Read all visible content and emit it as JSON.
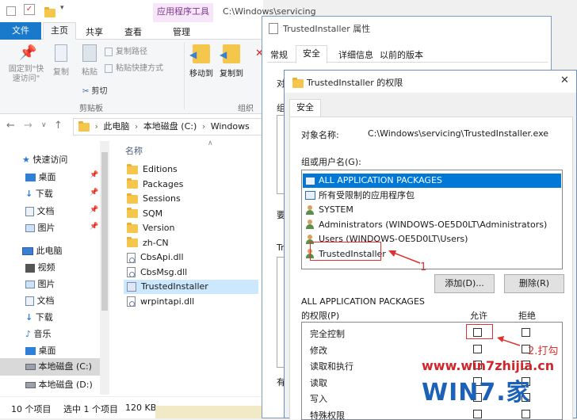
{
  "explorer": {
    "title_path": "C:\\Windows\\servicing",
    "app_tools_tab": "应用程序工具",
    "ribbon_tabs": [
      "文件",
      "主页",
      "共享",
      "查看",
      "管理"
    ],
    "pin_label": "固定到\"快\n速访问\"",
    "copy_label": "复制",
    "paste_label": "粘贴",
    "copy_path_label": "复制路径",
    "paste_shortcut_label": "粘贴快捷方式",
    "cut_label": "剪切",
    "clipboard_group": "剪贴板",
    "move_to_label": "移动到",
    "copy_to_label": "复制到",
    "organize_group": "组织",
    "breadcrumb": [
      "此电脑",
      "本地磁盘 (C:)",
      "Windows"
    ],
    "nav": [
      {
        "label": "快速访问"
      },
      {
        "label": "桌面"
      },
      {
        "label": "下载"
      },
      {
        "label": "文档"
      },
      {
        "label": "图片"
      },
      {
        "label": "此电脑"
      },
      {
        "label": "视频"
      },
      {
        "label": "图片"
      },
      {
        "label": "文档"
      },
      {
        "label": "下载"
      },
      {
        "label": "音乐"
      },
      {
        "label": "桌面"
      },
      {
        "label": "本地磁盘 (C:)"
      },
      {
        "label": "本地磁盘 (D:)"
      }
    ],
    "column_name": "名称",
    "files": [
      {
        "name": "Editions",
        "type": "folder"
      },
      {
        "name": "Packages",
        "type": "folder"
      },
      {
        "name": "Sessions",
        "type": "folder"
      },
      {
        "name": "SQM",
        "type": "folder"
      },
      {
        "name": "Version",
        "type": "folder"
      },
      {
        "name": "zh-CN",
        "type": "folder"
      },
      {
        "name": "CbsApi.dll",
        "type": "dll"
      },
      {
        "name": "CbsMsg.dll",
        "type": "dll"
      },
      {
        "name": "TrustedInstaller",
        "type": "exe"
      },
      {
        "name": "wrpintapi.dll",
        "type": "dll"
      }
    ],
    "status_count": "10 个项目",
    "status_selected": "选中 1 个项目",
    "status_size": "120 KB"
  },
  "props": {
    "title": "TrustedInstaller 属性",
    "tabs": [
      "常规",
      "安全",
      "详细信息",
      "以前的版本"
    ],
    "peek_labels": [
      "对",
      "组",
      "要",
      "Tr",
      "有"
    ]
  },
  "perm": {
    "title": "TrustedInstaller 的权限",
    "tab": "安全",
    "object_label": "对象名称:",
    "object_value": "C:\\Windows\\servicing\\TrustedInstaller.exe",
    "group_label": "组或用户名(G):",
    "users": [
      {
        "name": "ALL APPLICATION PACKAGES",
        "icon": "package"
      },
      {
        "name": "所有受限制的应用程序包",
        "icon": "package"
      },
      {
        "name": "SYSTEM",
        "icon": "user"
      },
      {
        "name": "Administrators (WINDOWS-OE5D0LT\\Administrators)",
        "icon": "user"
      },
      {
        "name": "Users (WINDOWS-OE5D0LT\\Users)",
        "icon": "user"
      },
      {
        "name": "TrustedInstaller",
        "icon": "user"
      }
    ],
    "add_button": "添加(D)...",
    "remove_button": "删除(R)",
    "perm_for": "ALL APPLICATION PACKAGES",
    "perm_for2": "的权限(P)",
    "allow_header": "允许",
    "deny_header": "拒绝",
    "permissions": [
      "完全控制",
      "修改",
      "读取和执行",
      "读取",
      "写入",
      "特殊权限"
    ]
  },
  "annotations": {
    "label1": "1",
    "label2": "2.打勾",
    "color": "#e03030"
  },
  "watermark": {
    "url": "www.win7zhijia.cn",
    "logo": "WIN7.家"
  }
}
